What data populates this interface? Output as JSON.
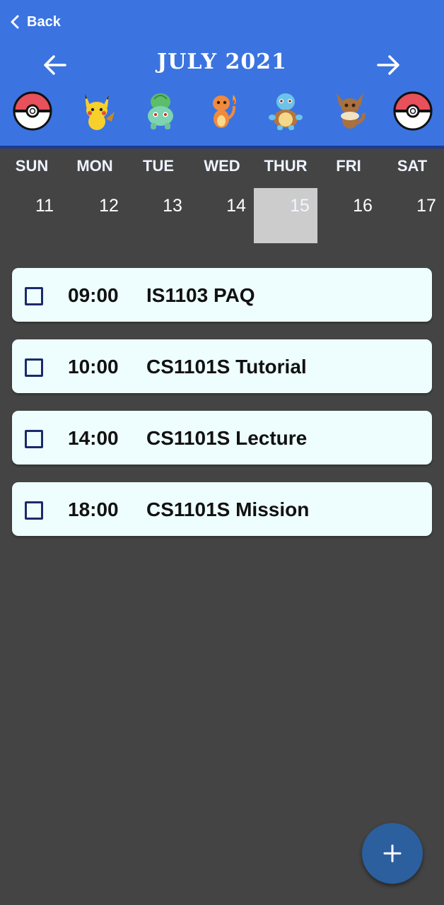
{
  "header": {
    "back_label": "Back",
    "month_title": "JULY 2021"
  },
  "pokemon_icons": [
    "pokeball-icon",
    "pikachu-icon",
    "bulbasaur-icon",
    "charmander-icon",
    "squirtle-icon",
    "eevee-icon",
    "pokeball-icon"
  ],
  "week": {
    "days": [
      "SUN",
      "MON",
      "TUE",
      "WED",
      "THUR",
      "FRI",
      "SAT"
    ],
    "dates": [
      "11",
      "12",
      "13",
      "14",
      "15",
      "16",
      "17"
    ],
    "selected_date": "15"
  },
  "tasks": [
    {
      "time": "09:00",
      "title": "IS1103 PAQ",
      "done": false
    },
    {
      "time": "10:00",
      "title": "CS1101S Tutorial",
      "done": false
    },
    {
      "time": "14:00",
      "title": "CS1101S Lecture",
      "done": false
    },
    {
      "time": "18:00",
      "title": "CS1101S Mission",
      "done": false
    }
  ],
  "fab": {
    "icon": "plus-icon"
  },
  "colors": {
    "header": "#3b74e0",
    "background": "#444444",
    "task_card": "#eefdfd",
    "selected_date": "#cccccc",
    "fab": "#2b5f9e"
  }
}
